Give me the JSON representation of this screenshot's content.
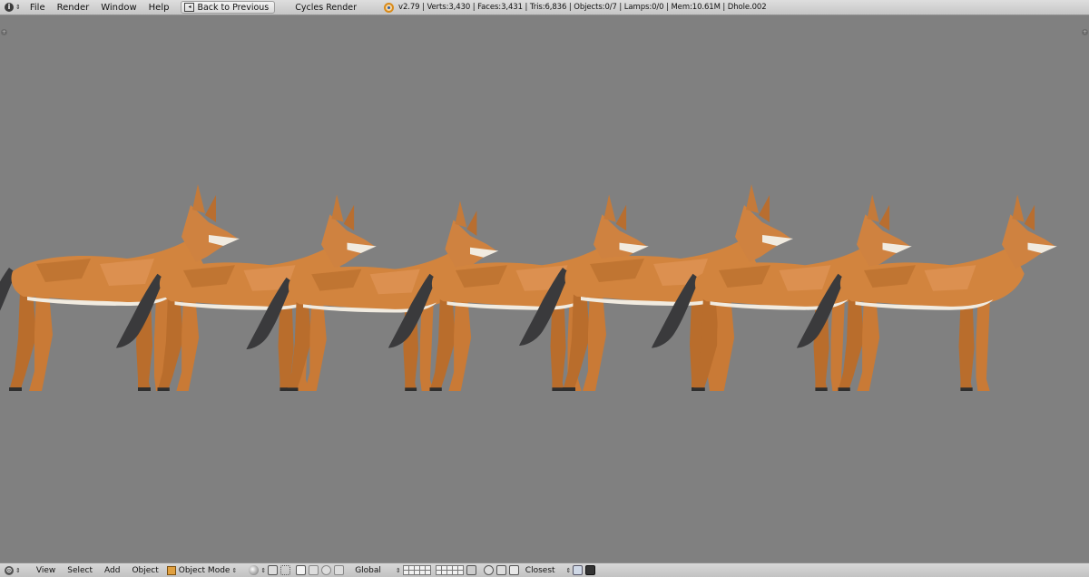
{
  "topbar": {
    "menus": [
      "File",
      "Render",
      "Window",
      "Help"
    ],
    "back_button": "Back to Previous",
    "render_engine": "Cycles Render",
    "stats": "v2.79 | Verts:3,430 | Faces:3,431 | Tris:6,836 | Objects:0/7 | Lamps:0/0 | Mem:10.61M | Dhole.002"
  },
  "bottombar": {
    "menus": [
      "View",
      "Select",
      "Add",
      "Object"
    ],
    "mode": "Object Mode",
    "orientation": "Global",
    "snap_target": "Closest"
  },
  "colors": {
    "fur": "#d2843e",
    "tail": "#3a3a3c",
    "belly": "#f1ebe0",
    "background": "#808080"
  },
  "icons": [
    "info-icon",
    "back-icon",
    "blender-logo-icon",
    "cube-icon",
    "shading-sphere-icon",
    "pivot-icon",
    "manipulator-icon",
    "layer-icon",
    "lock-icon",
    "snap-icon",
    "render-icon",
    "camera-icon"
  ]
}
